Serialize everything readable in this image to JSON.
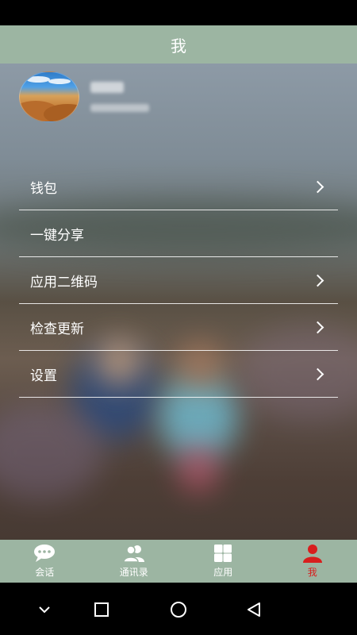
{
  "header": {
    "title": "我"
  },
  "menu": {
    "items": [
      {
        "label": "钱包",
        "chevron": true
      },
      {
        "label": "一键分享",
        "chevron": false
      },
      {
        "label": "应用二维码",
        "chevron": true
      },
      {
        "label": "检查更新",
        "chevron": true
      },
      {
        "label": "设置",
        "chevron": true
      }
    ]
  },
  "tabbar": {
    "items": [
      {
        "label": "会话",
        "icon": "chat-bubble-icon"
      },
      {
        "label": "通讯录",
        "icon": "contacts-icon"
      },
      {
        "label": "应用",
        "icon": "apps-grid-icon"
      },
      {
        "label": "我",
        "icon": "person-icon",
        "active": true
      }
    ],
    "accent": "#9cb5a2",
    "active_color": "#d81e1e"
  },
  "navbar": {
    "buttons": [
      "back-chevron-icon",
      "recent-apps-icon",
      "home-icon",
      "back-icon"
    ]
  }
}
